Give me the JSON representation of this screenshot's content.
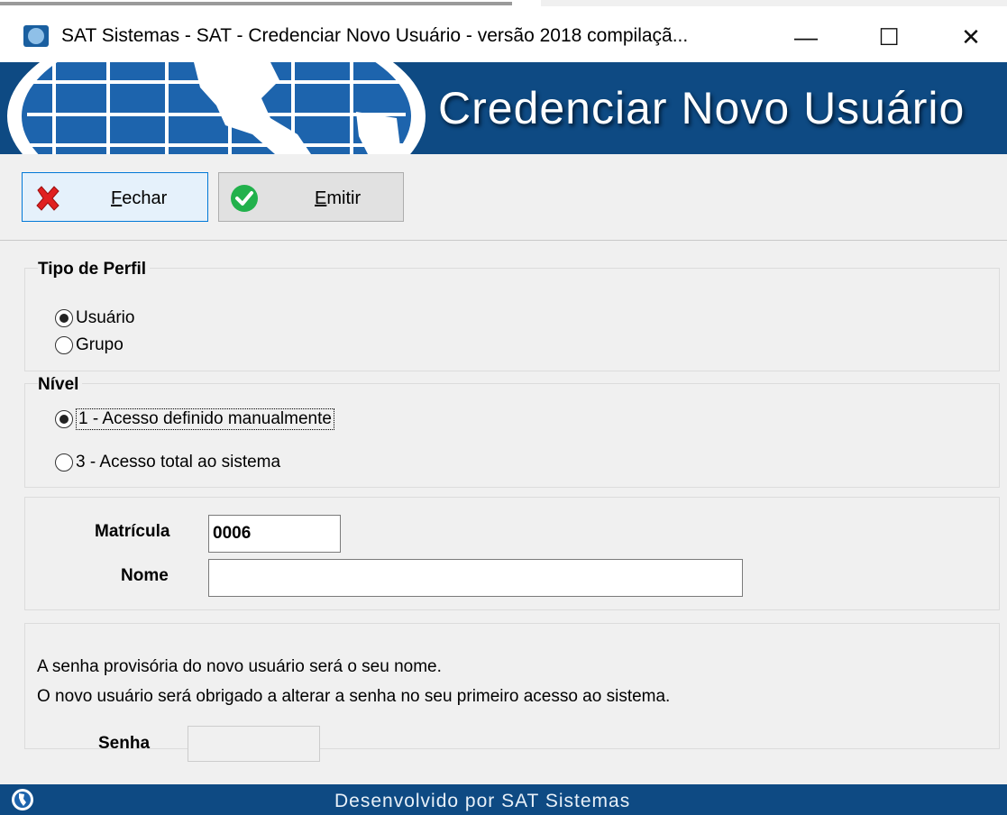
{
  "window": {
    "title": "SAT Sistemas - SAT - Credenciar Novo Usuário - versão 2018 compilaçã...",
    "minimize": "—",
    "maximize": "☐",
    "close": "✕"
  },
  "banner": {
    "title": "Credenciar Novo Usuário"
  },
  "toolbar": {
    "fechar_mnemonic": "F",
    "fechar_rest": "echar",
    "emitir_mnemonic": "E",
    "emitir_rest": "mitir"
  },
  "tipo_perfil": {
    "title": "Tipo de Perfil",
    "options": [
      {
        "label": "Usuário",
        "selected": true
      },
      {
        "label": "Grupo",
        "selected": false
      }
    ]
  },
  "nivel": {
    "title": "Nível",
    "options": [
      {
        "label": "1 - Acesso definido manualmente",
        "selected": true
      },
      {
        "label": "3 - Acesso total ao sistema",
        "selected": false
      }
    ]
  },
  "form": {
    "matricula_label": "Matrícula",
    "matricula_value": "0006",
    "nome_label": "Nome",
    "nome_value": ""
  },
  "senha": {
    "info_line1": "A senha provisória do novo usuário será o seu nome.",
    "info_line2": "O novo usuário será obrigado a alterar a senha no seu primeiro acesso ao sistema.",
    "label": "Senha",
    "value": ""
  },
  "footer": {
    "text": "Desenvolvido por SAT Sistemas"
  },
  "colors": {
    "banner": "#0e4a83",
    "focus_border": "#0078d7",
    "close_red": "#e02020",
    "ok_green": "#22b14c"
  }
}
